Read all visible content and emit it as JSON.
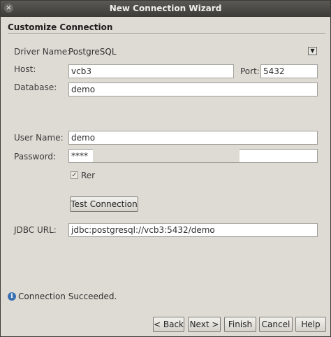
{
  "window": {
    "title": "New Connection Wizard",
    "close_glyph": "×"
  },
  "section": {
    "title": "Customize Connection"
  },
  "driver": {
    "label": "Driver Name:",
    "value": "PostgreSQL",
    "dropdown_icon": "chevron-down-icon"
  },
  "host": {
    "label": "Host:",
    "value": "vcb3"
  },
  "port": {
    "label": "Port:",
    "value": "5432"
  },
  "database": {
    "label": "Database:",
    "value": "demo"
  },
  "user": {
    "label": "User Name:",
    "value": "demo"
  },
  "password": {
    "label": "Password:",
    "value": "****"
  },
  "remember": {
    "label": "Rer",
    "checked": true
  },
  "test_button": {
    "label": "Test Connection"
  },
  "jdbc": {
    "label": "JDBC URL:",
    "value": "jdbc:postgresql://vcb3:5432/demo"
  },
  "status": {
    "icon": "info-icon",
    "text": "Connection Succeeded."
  },
  "buttons": {
    "back": "< Back",
    "next": "Next >",
    "finish": "Finish",
    "cancel": "Cancel",
    "help": "Help"
  }
}
